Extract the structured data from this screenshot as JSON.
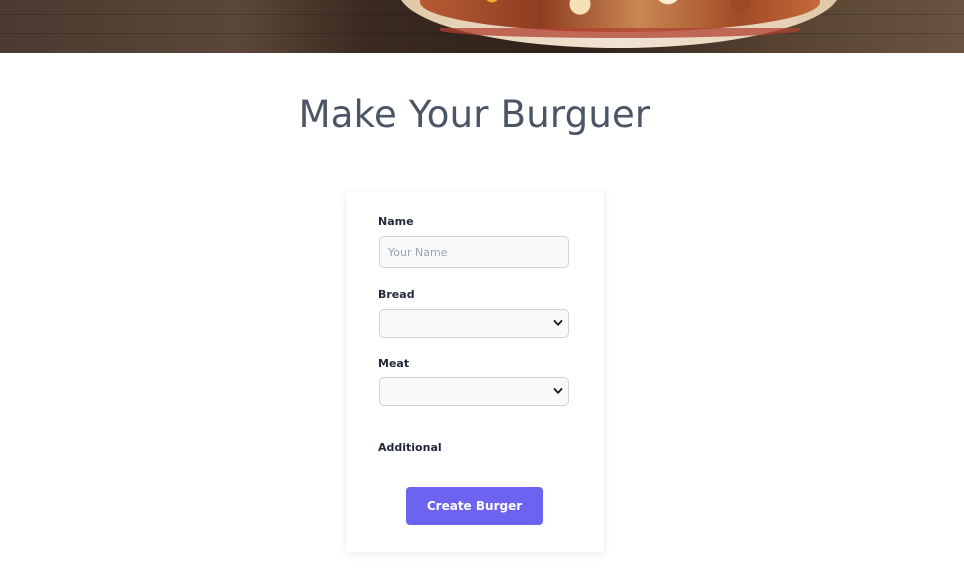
{
  "page": {
    "title": "Make Your Burguer"
  },
  "form": {
    "name_label": "Name",
    "name_placeholder": "Your Name",
    "name_value": "",
    "bread_label": "Bread",
    "bread_value": "",
    "meat_label": "Meat",
    "meat_value": "",
    "additional_label": "Additional",
    "submit_label": "Create Burger"
  },
  "colors": {
    "accent": "#6c63f0",
    "title": "#4a5565",
    "field_bg": "#f8f9fb",
    "field_border": "#cfd4da"
  },
  "icons": {
    "select_chevron": "chevron-down-icon"
  }
}
